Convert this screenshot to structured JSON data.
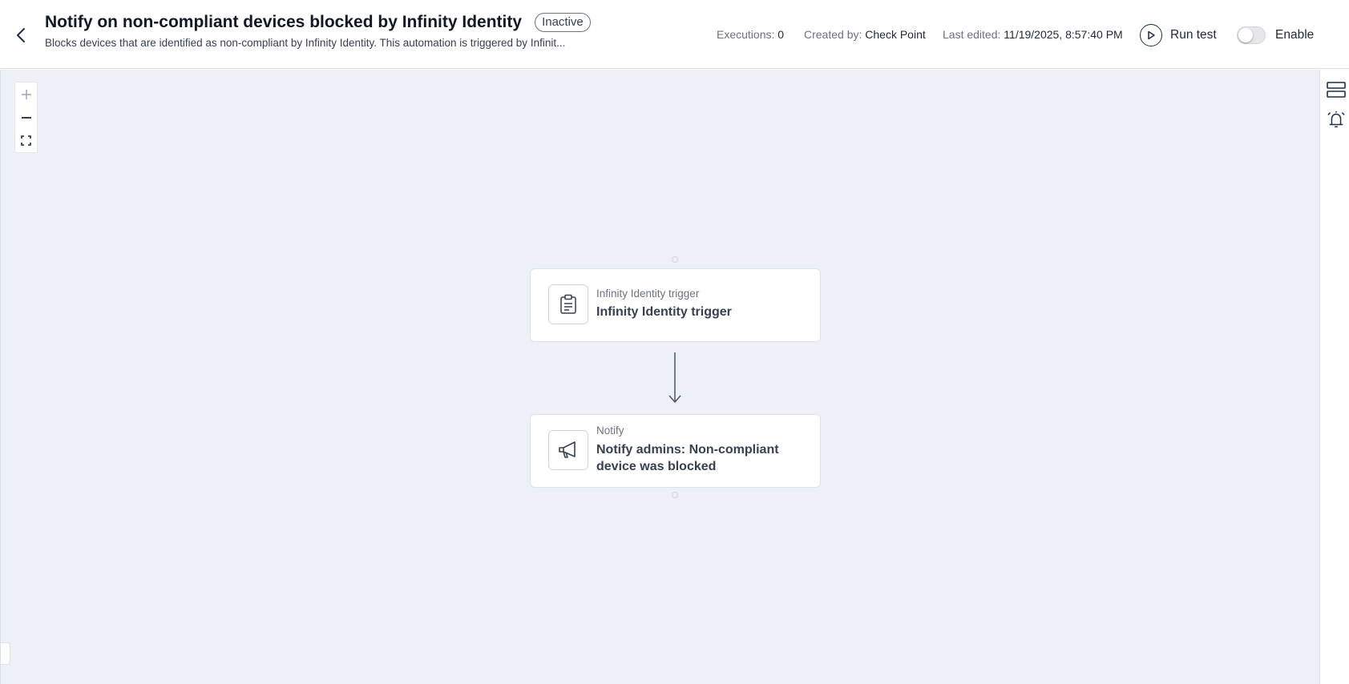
{
  "header": {
    "back_icon": "chevron-left-icon",
    "title": "Notify on non-compliant devices blocked by Infinity Identity",
    "status": "Inactive",
    "description": "Blocks devices that are identified as non-compliant by Infinity Identity. This automation is triggered by Infinit...",
    "executions_label": "Executions:",
    "executions_value": "0",
    "created_by_label": "Created by:",
    "created_by_value": "Check Point",
    "last_edited_label": "Last edited:",
    "last_edited_value": "11/19/2025, 8:57:40 PM",
    "run_test_label": "Run test",
    "run_test_icon": "play-circle-icon",
    "enable_label": "Enable",
    "enabled": false
  },
  "canvas": {
    "zoom_controls": [
      "zoom-in-icon",
      "zoom-out-icon",
      "fit-view-icon"
    ],
    "nodes": [
      {
        "type": "Infinity Identity trigger",
        "title": "Infinity Identity trigger",
        "icon": "clipboard-icon"
      },
      {
        "type": "Notify",
        "title": "Notify admins: Non-compliant device was blocked",
        "icon": "megaphone-icon"
      }
    ]
  },
  "right_rail": {
    "icons": [
      "layout-rows-icon",
      "alarm-bell-icon"
    ]
  },
  "colors": {
    "canvas_bg": "#edf0f7",
    "edge": "#4b5563",
    "text_primary": "#111827"
  }
}
